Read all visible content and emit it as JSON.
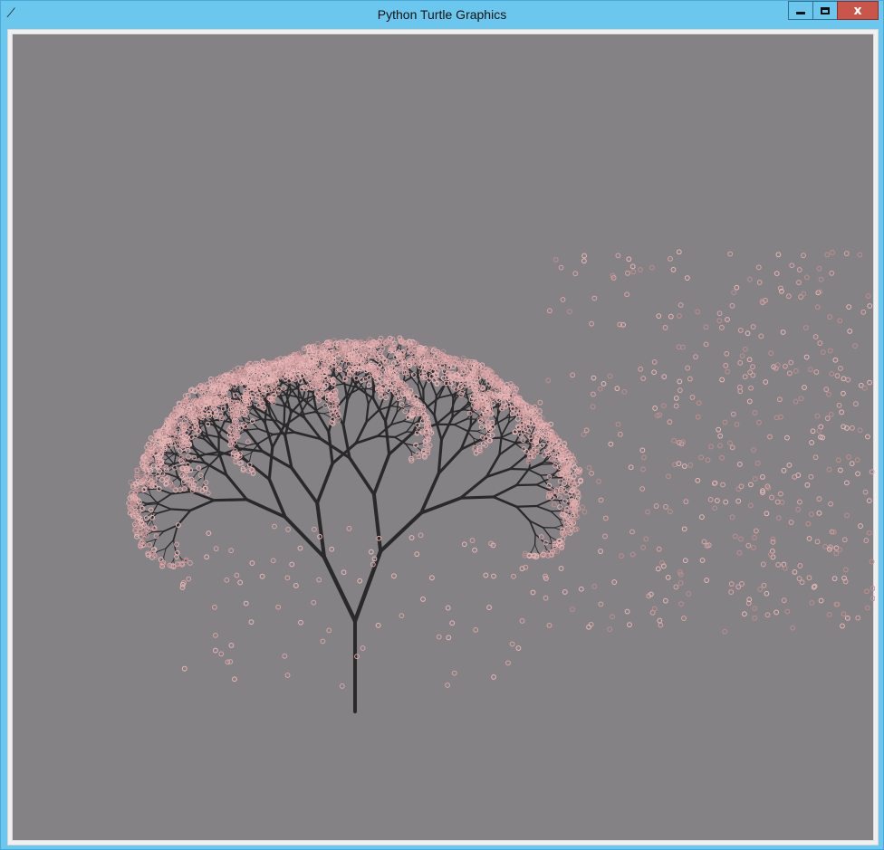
{
  "window": {
    "title": "Python Turtle Graphics",
    "app_icon": "feather-icon",
    "controls": {
      "minimize": "minimize-icon",
      "maximize": "maximize-icon",
      "close_label": "x"
    }
  },
  "canvas": {
    "background": "#858285",
    "trunk_color": "#2a292a",
    "blossom_colors": [
      "#e8b7b8",
      "#d8a5a6",
      "#bb8f91",
      "#5a4a4c"
    ]
  }
}
